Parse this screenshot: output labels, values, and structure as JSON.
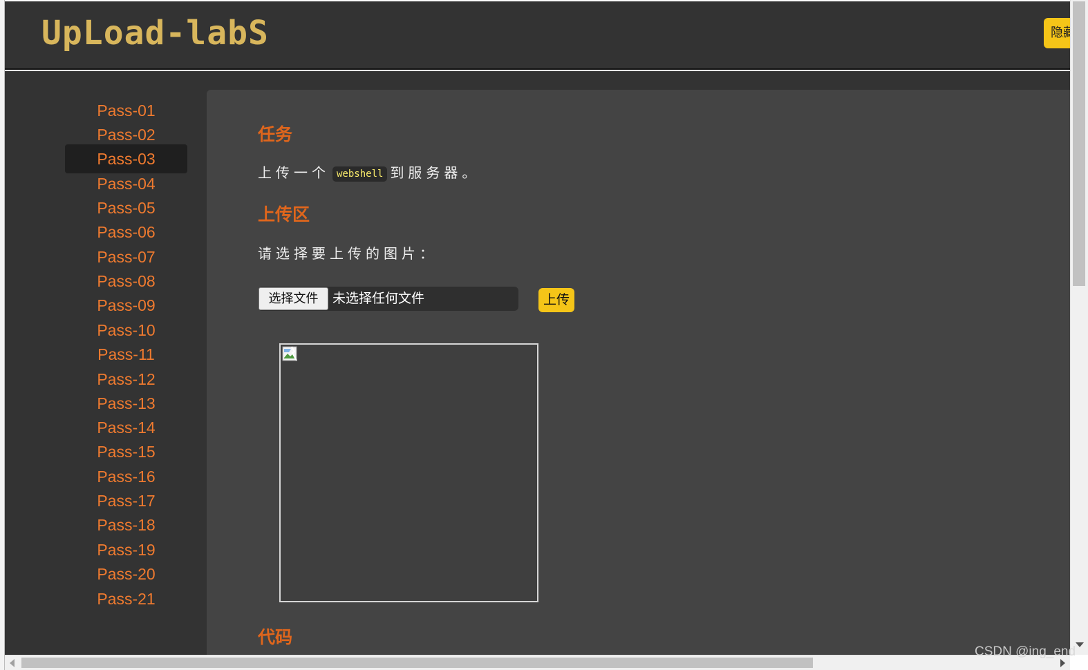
{
  "header": {
    "logo": "UpLoad-labS",
    "hide_button_label": "隐藏"
  },
  "sidebar": {
    "items": [
      {
        "label": "Pass-01",
        "active": false
      },
      {
        "label": "Pass-02",
        "active": false
      },
      {
        "label": "Pass-03",
        "active": true
      },
      {
        "label": "Pass-04",
        "active": false
      },
      {
        "label": "Pass-05",
        "active": false
      },
      {
        "label": "Pass-06",
        "active": false
      },
      {
        "label": "Pass-07",
        "active": false
      },
      {
        "label": "Pass-08",
        "active": false
      },
      {
        "label": "Pass-09",
        "active": false
      },
      {
        "label": "Pass-10",
        "active": false
      },
      {
        "label": "Pass-11",
        "active": false
      },
      {
        "label": "Pass-12",
        "active": false
      },
      {
        "label": "Pass-13",
        "active": false
      },
      {
        "label": "Pass-14",
        "active": false
      },
      {
        "label": "Pass-15",
        "active": false
      },
      {
        "label": "Pass-16",
        "active": false
      },
      {
        "label": "Pass-17",
        "active": false
      },
      {
        "label": "Pass-18",
        "active": false
      },
      {
        "label": "Pass-19",
        "active": false
      },
      {
        "label": "Pass-20",
        "active": false
      },
      {
        "label": "Pass-21",
        "active": false
      }
    ]
  },
  "main": {
    "task_title": "任务",
    "task_text_before": "上传一个",
    "task_code": "webshell",
    "task_text_after": "到服务器。",
    "upload_title": "上传区",
    "upload_prompt": "请选择要上传的图片：",
    "choose_file_label": "选择文件",
    "file_status": "未选择任何文件",
    "upload_button_label": "上传",
    "code_title": "代码"
  },
  "watermark": "CSDN @ing_end",
  "colors": {
    "accent_orange": "#e0661c",
    "nav_orange": "#ef7a2f",
    "button_yellow": "#f5c518",
    "logo_gold": "#d8b65c",
    "header_bg": "#333333",
    "content_bg": "#444444"
  },
  "icons": {
    "broken_image": "broken-image-icon"
  }
}
